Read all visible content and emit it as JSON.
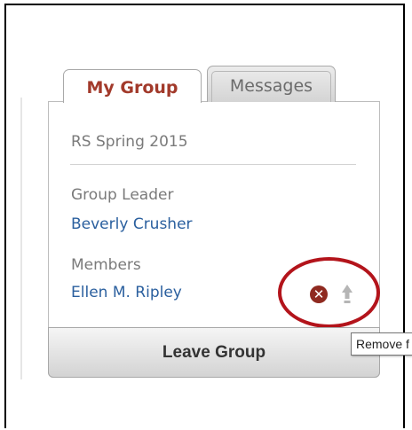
{
  "tabs": [
    {
      "label": "My Group",
      "active": true
    },
    {
      "label": "Messages",
      "active": false
    }
  ],
  "group": {
    "name": "RS Spring 2015",
    "leader_label": "Group Leader",
    "leader_name": "Beverly Crusher",
    "members_label": "Members",
    "members": [
      {
        "name": "Ellen M. Ripley",
        "actions": [
          "remove-icon",
          "promote-icon"
        ]
      }
    ]
  },
  "leave_button": "Leave Group",
  "tooltip": "Remove f",
  "icons": {
    "remove_glyph": "✕"
  },
  "colors": {
    "active_tab_text": "#a23a2b",
    "link_blue": "#2a5f9e",
    "highlight_circle": "#b3141b",
    "remove_icon_bg": "#8f2a20"
  }
}
